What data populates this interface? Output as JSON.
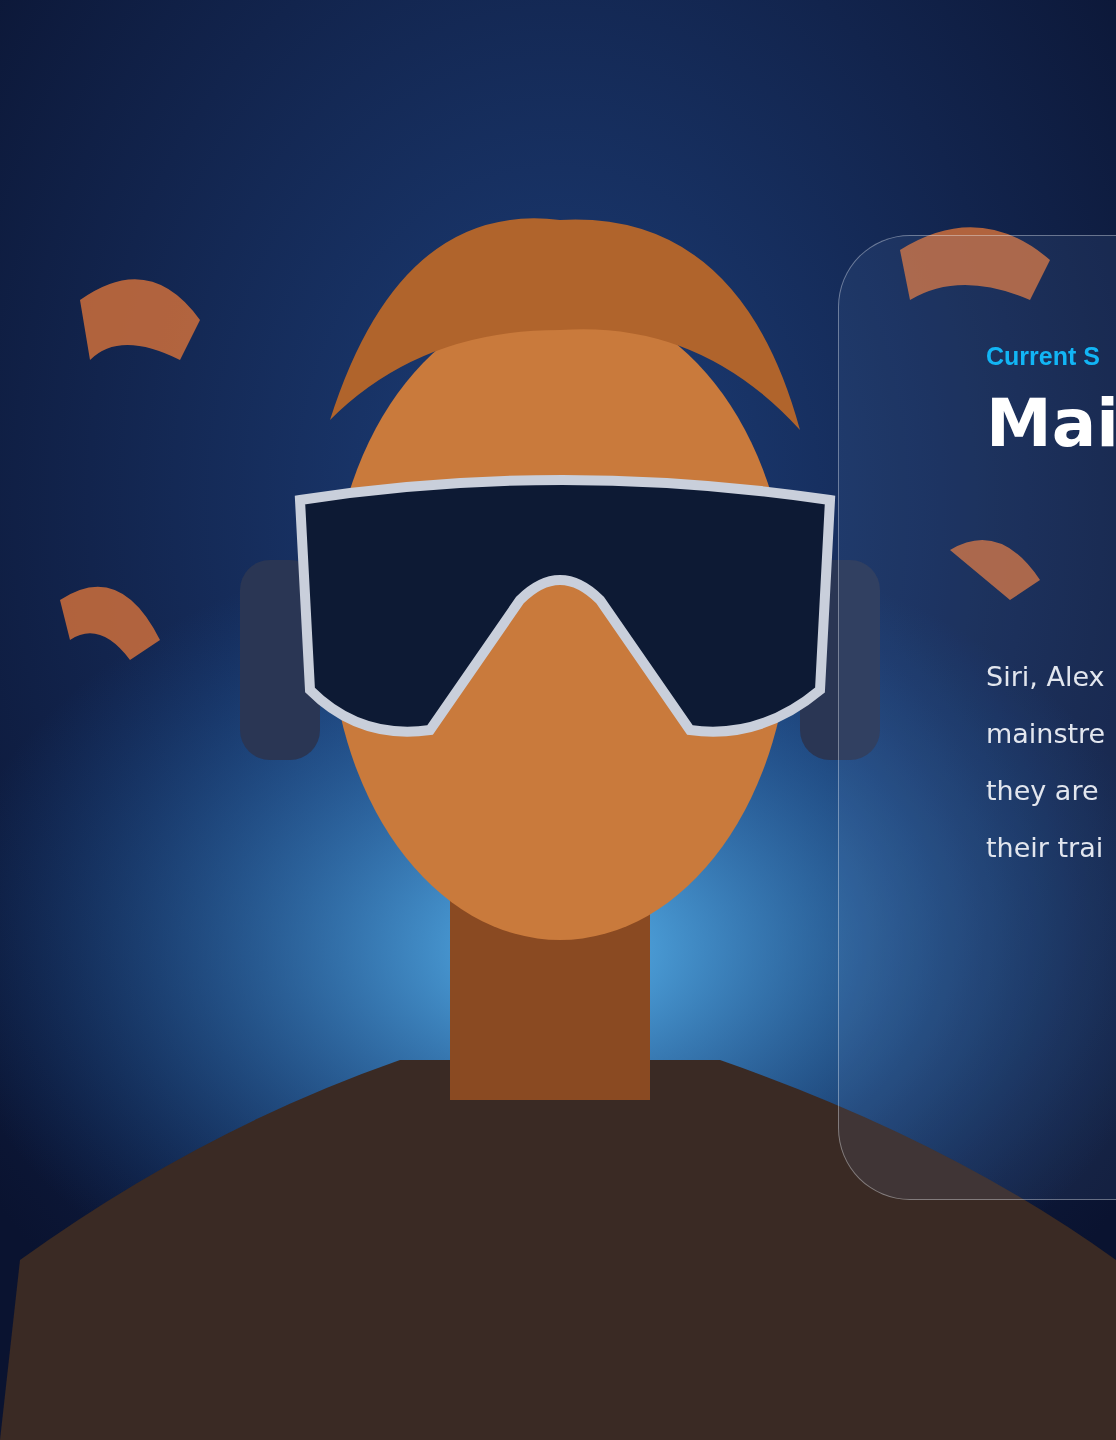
{
  "card": {
    "eyebrow": "Current S",
    "title": "Mai",
    "body_lines": [
      "Siri, Alex",
      "mainstre",
      "they are",
      "their trai"
    ]
  }
}
